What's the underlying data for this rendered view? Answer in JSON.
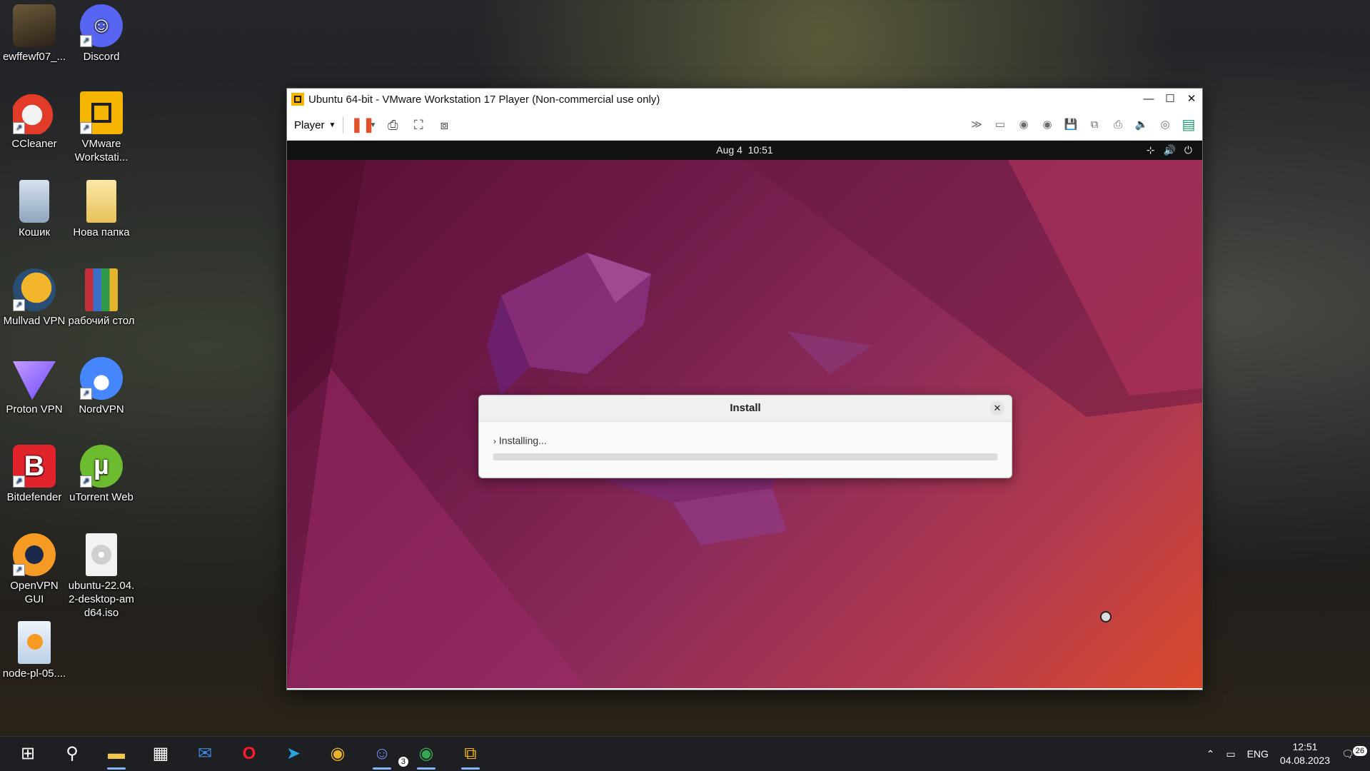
{
  "desktop": {
    "icons": [
      {
        "label": "ewffewf07_...",
        "icon": "game-thumbnail-icon",
        "color": "#5a4a2a"
      },
      {
        "label": "Discord",
        "icon": "discord-icon",
        "color": "#5865f2"
      },
      {
        "label": "CCleaner",
        "icon": "ccleaner-icon",
        "color": "#e23b2a"
      },
      {
        "label": "VMware Workstati...",
        "icon": "vmware-icon",
        "color": "#f5b400"
      },
      {
        "label": "Кошик",
        "icon": "recycle-bin-icon",
        "color": "#9fb3c8"
      },
      {
        "label": "Нова папка",
        "icon": "folder-icon",
        "color": "#f4d36b"
      },
      {
        "label": "Mullvad VPN",
        "icon": "mullvad-icon",
        "color": "#f2b52b"
      },
      {
        "label": "рабочий стол",
        "icon": "archive-icon",
        "color": "#8b2e6e"
      },
      {
        "label": "Proton VPN",
        "icon": "protonvpn-icon",
        "color": "#7b3fe4"
      },
      {
        "label": "NordVPN",
        "icon": "nordvpn-icon",
        "color": "#4687ff"
      },
      {
        "label": "Bitdefender",
        "icon": "bitdefender-icon",
        "color": "#e1232c"
      },
      {
        "label": "uTorrent Web",
        "icon": "utorrent-icon",
        "color": "#6dbb2f"
      },
      {
        "label": "OpenVPN GUI",
        "icon": "openvpn-icon",
        "color": "#f59a23"
      },
      {
        "label": "ubuntu-22.04.2-desktop-amd64.iso",
        "icon": "disc-image-icon",
        "color": "#e0e0e0"
      },
      {
        "label": "node-pl-05....",
        "icon": "openvpn-config-icon",
        "color": "#f59a23"
      }
    ]
  },
  "vmware": {
    "title": "Ubuntu 64-bit - VMware Workstation 17 Player (Non-commercial use only)",
    "minimize": "—",
    "maximize": "☐",
    "close": "✕",
    "player_menu": "Player"
  },
  "guest": {
    "date": "Aug 4",
    "time": "10:51",
    "dialog": {
      "title": "Install",
      "status": "Installing...",
      "progress": 0.0
    }
  },
  "taskbar": {
    "lang": "ENG",
    "time": "12:51",
    "date": "04.08.2023",
    "notif_count": "26",
    "discord_badge": "3"
  }
}
